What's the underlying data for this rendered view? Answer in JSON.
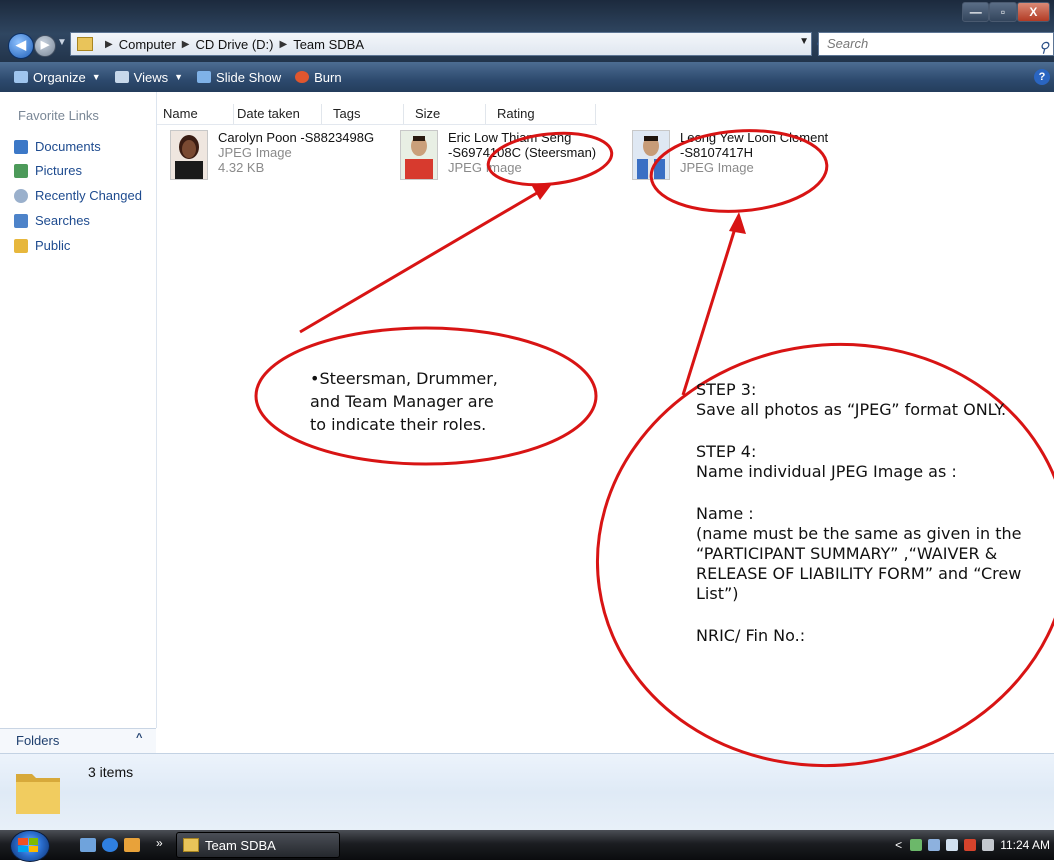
{
  "window": {
    "buttons": {
      "minimize": "—",
      "maximize": "▫",
      "close": "X"
    }
  },
  "address_bar": {
    "crumbs": [
      "Computer",
      "CD Drive (D:)",
      "Team SDBA"
    ],
    "search_placeholder": "Search"
  },
  "toolbar": {
    "items": [
      {
        "label": "Organize",
        "icon": "organize-icon",
        "dropdown": true
      },
      {
        "label": "Views",
        "icon": "views-icon",
        "dropdown": true
      },
      {
        "label": "Slide Show",
        "icon": "slideshow-icon"
      },
      {
        "label": "Burn",
        "icon": "burn-icon"
      }
    ],
    "help": "?"
  },
  "sidebar": {
    "title": "Favorite Links",
    "items": [
      {
        "label": "Documents",
        "icon": "documents-icon"
      },
      {
        "label": "Pictures",
        "icon": "pictures-icon"
      },
      {
        "label": "Recently Changed",
        "icon": "recently-changed-icon"
      },
      {
        "label": "Searches",
        "icon": "searches-icon"
      },
      {
        "label": "Public",
        "icon": "public-icon"
      }
    ],
    "folders_label": "Folders"
  },
  "columns": [
    "Name",
    "Date taken",
    "Tags",
    "Size",
    "Rating"
  ],
  "files": [
    {
      "line1": "Carolyn Poon -S8823498G",
      "line2": "JPEG Image",
      "line3": "4.32 KB",
      "thumb_color": "#6b3a2a"
    },
    {
      "line1": "Eric Low Thiam Seng",
      "line2": "-S6974108C (Steersman)",
      "line3": "JPEG Image",
      "thumb_color": "#d73a2e"
    },
    {
      "line1": "Leong Yew Loon Clement",
      "line2": "-S8107417H",
      "line3": "JPEG Image",
      "thumb_color": "#3a6fc4"
    }
  ],
  "details": {
    "items_count": "3 items"
  },
  "taskbar": {
    "task_label": "Team SDBA",
    "clock": "11:24 AM",
    "more": "»"
  },
  "annotations": {
    "note": [
      "•Steersman, Drummer,",
      "and Team Manager are",
      "to indicate their  roles."
    ],
    "step3_title": "STEP 3:",
    "step3_text": "Save all photos as “JPEG” format ONLY.",
    "step4_title": "STEP 4:",
    "step4_text": "Name individual JPEG Image as :",
    "name_title": "Name :",
    "name_lines": [
      "(name must be the same as  given in the",
      "“PARTICIPANT SUMMARY” ,“WAIVER &",
      "RELEASE OF LIABILITY FORM” and “Crew",
      "List”)"
    ],
    "nric": "NRIC/ Fin No.:",
    "accent_color": "#d81414"
  }
}
